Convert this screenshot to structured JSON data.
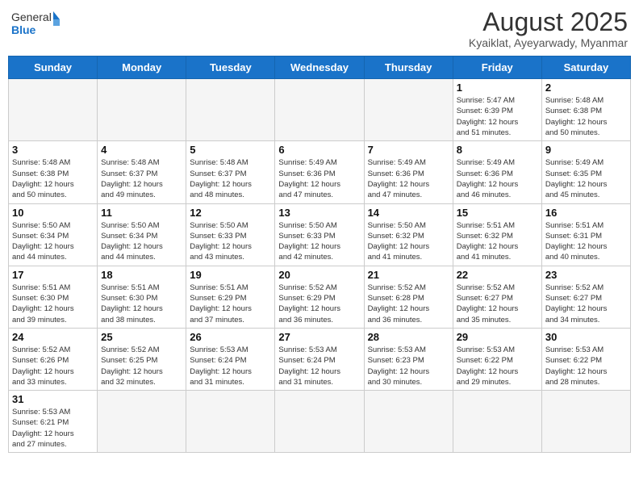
{
  "header": {
    "logo_general": "General",
    "logo_blue": "Blue",
    "month_title": "August 2025",
    "subtitle": "Kyaiklat, Ayeyarwady, Myanmar"
  },
  "weekdays": [
    "Sunday",
    "Monday",
    "Tuesday",
    "Wednesday",
    "Thursday",
    "Friday",
    "Saturday"
  ],
  "weeks": [
    [
      {
        "day": "",
        "info": ""
      },
      {
        "day": "",
        "info": ""
      },
      {
        "day": "",
        "info": ""
      },
      {
        "day": "",
        "info": ""
      },
      {
        "day": "",
        "info": ""
      },
      {
        "day": "1",
        "info": "Sunrise: 5:47 AM\nSunset: 6:39 PM\nDaylight: 12 hours\nand 51 minutes."
      },
      {
        "day": "2",
        "info": "Sunrise: 5:48 AM\nSunset: 6:38 PM\nDaylight: 12 hours\nand 50 minutes."
      }
    ],
    [
      {
        "day": "3",
        "info": "Sunrise: 5:48 AM\nSunset: 6:38 PM\nDaylight: 12 hours\nand 50 minutes."
      },
      {
        "day": "4",
        "info": "Sunrise: 5:48 AM\nSunset: 6:37 PM\nDaylight: 12 hours\nand 49 minutes."
      },
      {
        "day": "5",
        "info": "Sunrise: 5:48 AM\nSunset: 6:37 PM\nDaylight: 12 hours\nand 48 minutes."
      },
      {
        "day": "6",
        "info": "Sunrise: 5:49 AM\nSunset: 6:36 PM\nDaylight: 12 hours\nand 47 minutes."
      },
      {
        "day": "7",
        "info": "Sunrise: 5:49 AM\nSunset: 6:36 PM\nDaylight: 12 hours\nand 47 minutes."
      },
      {
        "day": "8",
        "info": "Sunrise: 5:49 AM\nSunset: 6:36 PM\nDaylight: 12 hours\nand 46 minutes."
      },
      {
        "day": "9",
        "info": "Sunrise: 5:49 AM\nSunset: 6:35 PM\nDaylight: 12 hours\nand 45 minutes."
      }
    ],
    [
      {
        "day": "10",
        "info": "Sunrise: 5:50 AM\nSunset: 6:34 PM\nDaylight: 12 hours\nand 44 minutes."
      },
      {
        "day": "11",
        "info": "Sunrise: 5:50 AM\nSunset: 6:34 PM\nDaylight: 12 hours\nand 44 minutes."
      },
      {
        "day": "12",
        "info": "Sunrise: 5:50 AM\nSunset: 6:33 PM\nDaylight: 12 hours\nand 43 minutes."
      },
      {
        "day": "13",
        "info": "Sunrise: 5:50 AM\nSunset: 6:33 PM\nDaylight: 12 hours\nand 42 minutes."
      },
      {
        "day": "14",
        "info": "Sunrise: 5:50 AM\nSunset: 6:32 PM\nDaylight: 12 hours\nand 41 minutes."
      },
      {
        "day": "15",
        "info": "Sunrise: 5:51 AM\nSunset: 6:32 PM\nDaylight: 12 hours\nand 41 minutes."
      },
      {
        "day": "16",
        "info": "Sunrise: 5:51 AM\nSunset: 6:31 PM\nDaylight: 12 hours\nand 40 minutes."
      }
    ],
    [
      {
        "day": "17",
        "info": "Sunrise: 5:51 AM\nSunset: 6:30 PM\nDaylight: 12 hours\nand 39 minutes."
      },
      {
        "day": "18",
        "info": "Sunrise: 5:51 AM\nSunset: 6:30 PM\nDaylight: 12 hours\nand 38 minutes."
      },
      {
        "day": "19",
        "info": "Sunrise: 5:51 AM\nSunset: 6:29 PM\nDaylight: 12 hours\nand 37 minutes."
      },
      {
        "day": "20",
        "info": "Sunrise: 5:52 AM\nSunset: 6:29 PM\nDaylight: 12 hours\nand 36 minutes."
      },
      {
        "day": "21",
        "info": "Sunrise: 5:52 AM\nSunset: 6:28 PM\nDaylight: 12 hours\nand 36 minutes."
      },
      {
        "day": "22",
        "info": "Sunrise: 5:52 AM\nSunset: 6:27 PM\nDaylight: 12 hours\nand 35 minutes."
      },
      {
        "day": "23",
        "info": "Sunrise: 5:52 AM\nSunset: 6:27 PM\nDaylight: 12 hours\nand 34 minutes."
      }
    ],
    [
      {
        "day": "24",
        "info": "Sunrise: 5:52 AM\nSunset: 6:26 PM\nDaylight: 12 hours\nand 33 minutes."
      },
      {
        "day": "25",
        "info": "Sunrise: 5:52 AM\nSunset: 6:25 PM\nDaylight: 12 hours\nand 32 minutes."
      },
      {
        "day": "26",
        "info": "Sunrise: 5:53 AM\nSunset: 6:24 PM\nDaylight: 12 hours\nand 31 minutes."
      },
      {
        "day": "27",
        "info": "Sunrise: 5:53 AM\nSunset: 6:24 PM\nDaylight: 12 hours\nand 31 minutes."
      },
      {
        "day": "28",
        "info": "Sunrise: 5:53 AM\nSunset: 6:23 PM\nDaylight: 12 hours\nand 30 minutes."
      },
      {
        "day": "29",
        "info": "Sunrise: 5:53 AM\nSunset: 6:22 PM\nDaylight: 12 hours\nand 29 minutes."
      },
      {
        "day": "30",
        "info": "Sunrise: 5:53 AM\nSunset: 6:22 PM\nDaylight: 12 hours\nand 28 minutes."
      }
    ],
    [
      {
        "day": "31",
        "info": "Sunrise: 5:53 AM\nSunset: 6:21 PM\nDaylight: 12 hours\nand 27 minutes."
      },
      {
        "day": "",
        "info": ""
      },
      {
        "day": "",
        "info": ""
      },
      {
        "day": "",
        "info": ""
      },
      {
        "day": "",
        "info": ""
      },
      {
        "day": "",
        "info": ""
      },
      {
        "day": "",
        "info": ""
      }
    ]
  ]
}
